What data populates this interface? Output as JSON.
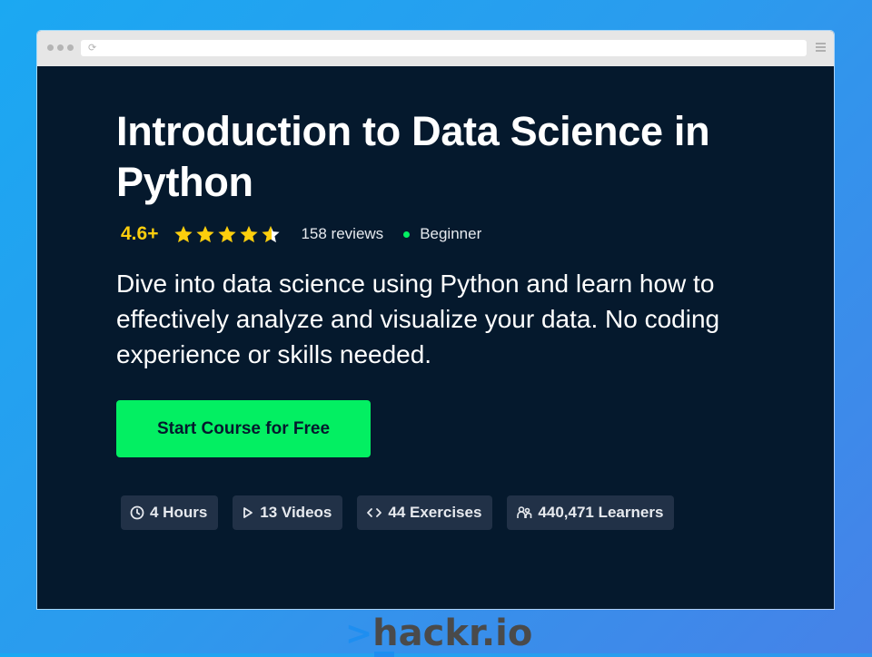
{
  "browser": {
    "url": "",
    "icons": {
      "dots": "window-controls-icon",
      "reload": "reload-icon",
      "menu": "hamburger-menu-icon"
    }
  },
  "course": {
    "title": "Introduction to Data Science in Python",
    "rating": "4.6+",
    "stars": 4.6,
    "reviews": "158 reviews",
    "level": "Beginner",
    "description": "Dive into data science using Python and learn how to effectively analyze and visualize your data. No coding experience or skills needed.",
    "cta_label": "Start Course for Free",
    "stats": [
      {
        "icon": "clock-icon",
        "label": "4 Hours"
      },
      {
        "icon": "play-icon",
        "label": "13 Videos"
      },
      {
        "icon": "code-icon",
        "label": "44 Exercises"
      },
      {
        "icon": "learners-icon",
        "label": "440,471 Learners"
      }
    ]
  },
  "brand": {
    "caret": ">",
    "name": "hackr.io"
  },
  "colors": {
    "page_bg": "#05192d",
    "accent_green": "#03ef62",
    "star_yellow": "#fcce0d",
    "chip_bg": "#213147",
    "brand_blue": "#1e8ef0"
  }
}
